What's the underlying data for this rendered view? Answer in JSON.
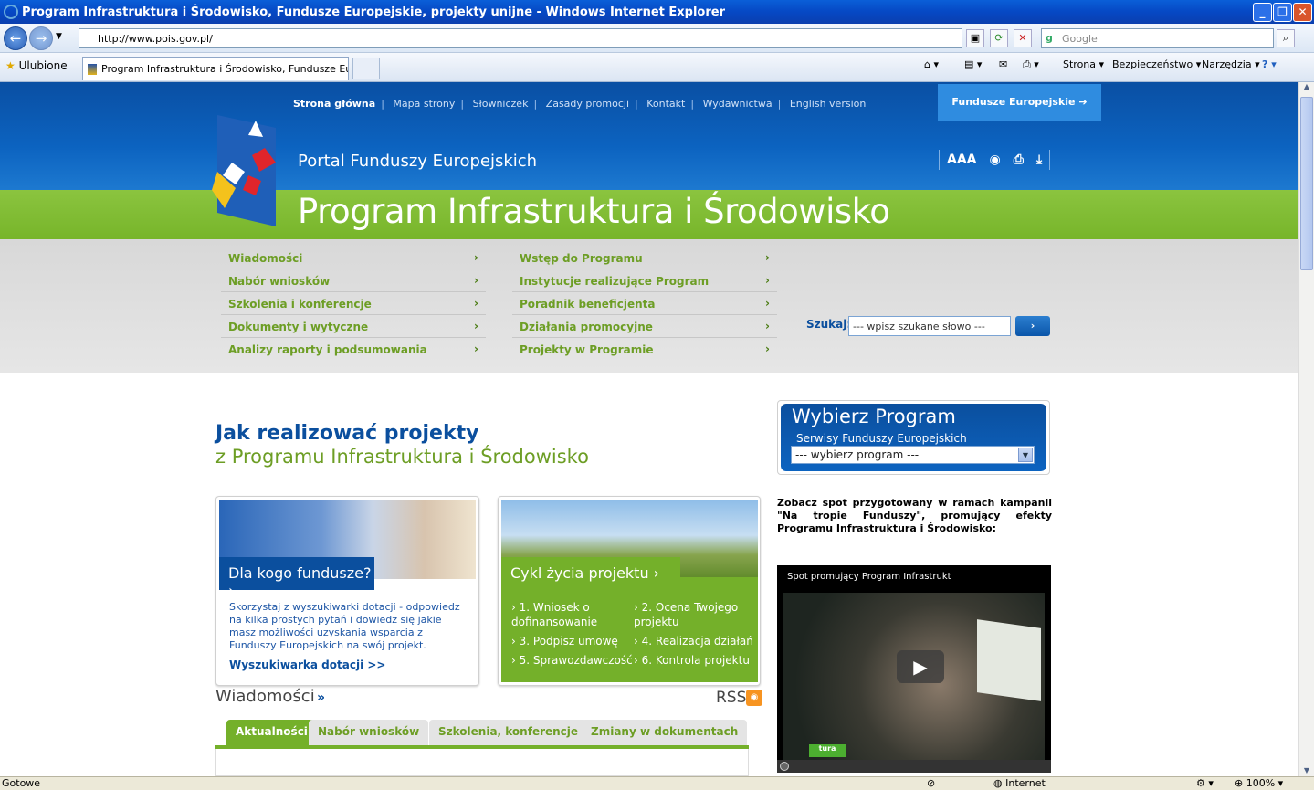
{
  "window": {
    "title": "Program Infrastruktura i Środowisko, Fundusze Europejskie, projekty unijne - Windows Internet Explorer"
  },
  "browser": {
    "url": "http://www.pois.gov.pl/",
    "search_placeholder": "Google",
    "favorites_label": "Ulubione",
    "tab_title": "Program Infrastruktura i Środowisko, Fundusze Europ...",
    "toolbar": {
      "page": "Strona",
      "safety": "Bezpieczeństwo",
      "tools": "Narzędzia"
    },
    "status_left": "Gotowe",
    "status_zone": "Internet",
    "zoom": "100%"
  },
  "page": {
    "topnav": [
      "Strona główna",
      "Mapa strony",
      "Słowniczek",
      "Zasady promocji",
      "Kontakt",
      "Wydawnictwa",
      "English version"
    ],
    "fundusze_button": "Fundusze Europejskie",
    "portal_title": "Portal Funduszy Europejskich",
    "program_title": "Program Infrastruktura i Środowisko",
    "tools_text_size": "AAA",
    "menu_left": [
      "Wiadomości",
      "Nabór wniosków",
      "Szkolenia i konferencje",
      "Dokumenty i wytyczne",
      "Analizy raporty i podsumowania"
    ],
    "menu_right": [
      "Wstęp do Programu",
      "Instytucje realizujące Program",
      "Poradnik beneficjenta",
      "Działania promocyjne",
      "Projekty w Programie"
    ],
    "search": {
      "label": "Szukaj:",
      "value": "--- wpisz szukane słowo ---",
      "button": "›"
    },
    "headline1": "Jak realizować projekty",
    "headline2": "z Programu Infrastruktura i Środowisko",
    "card1": {
      "label": "Dla kogo fundusze?",
      "text": "Skorzystaj z wyszukiwarki dotacji - odpowiedz na kilka prostych pytań i dowiedz się jakie masz możliwości uzyskania wsparcia z Funduszy Europejskich na swój projekt.",
      "link": "Wyszukiwarka dotacji >>"
    },
    "card2": {
      "label": "Cykl życia projektu",
      "steps": [
        "1. Wniosek o dofinansowanie",
        "2. Ocena Twojego projektu",
        "3. Podpisz umowę",
        "4. Realizacja działań",
        "5. Sprawozdawczość",
        "6. Kontrola projektu"
      ]
    },
    "news_title": "Wiadomości",
    "rss": "RSS",
    "news_tabs": [
      "Aktualności",
      "Nabór wniosków",
      "Szkolenia, konferencje",
      "Zmiany w dokumentach"
    ],
    "wybierz": {
      "title": "Wybierz Program",
      "subtitle": "Serwisy Funduszy Europejskich",
      "select": "--- wybierz program ---"
    },
    "zobacz": "Zobacz spot przygotowany w ramach kampanii \"Na tropie Funduszy\", promujący efekty Programu Infrastruktura i Środowisko:",
    "video_title": "Spot promujący Program Infrastrukt",
    "video_logo": "tura"
  }
}
